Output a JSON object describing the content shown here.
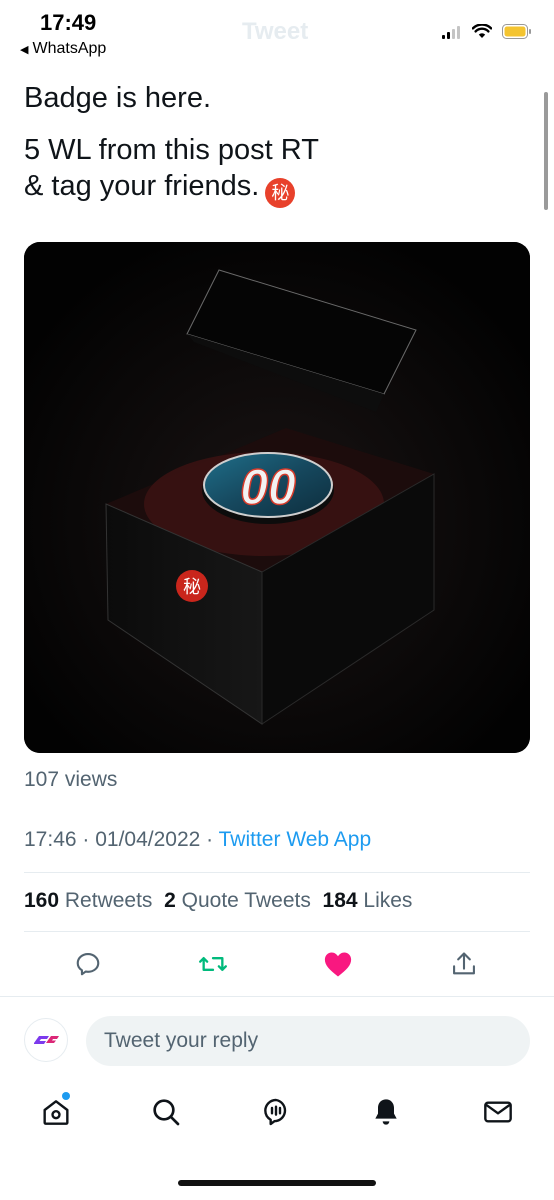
{
  "status_bar": {
    "time": "17:49",
    "back_app": "WhatsApp"
  },
  "nav": {
    "title": "Tweet"
  },
  "tweet": {
    "line1": "Badge is here.",
    "line2a": "5 WL from this post RT",
    "line2b": "& tag your friends.",
    "emoji": "秘",
    "image": {
      "badge_text": "00",
      "box_emblem": "秘"
    },
    "views": "107 views",
    "time": "17:46",
    "date": "01/04/2022",
    "source": "Twitter Web App",
    "retweets_count": "160",
    "retweets_label": "Retweets",
    "quotes_count": "2",
    "quotes_label": "Quote Tweets",
    "likes_count": "184",
    "likes_label": "Likes"
  },
  "reply": {
    "placeholder": "Tweet your reply"
  },
  "colors": {
    "accent": "#1d9bf0",
    "retweet": "#00ba7c",
    "like": "#f91880",
    "muted": "#536471"
  },
  "actions": [
    "reply-icon",
    "retweet-icon",
    "like-icon",
    "share-icon"
  ],
  "tabs": [
    "home-icon",
    "search-icon",
    "spaces-icon",
    "notifications-icon",
    "messages-icon"
  ]
}
